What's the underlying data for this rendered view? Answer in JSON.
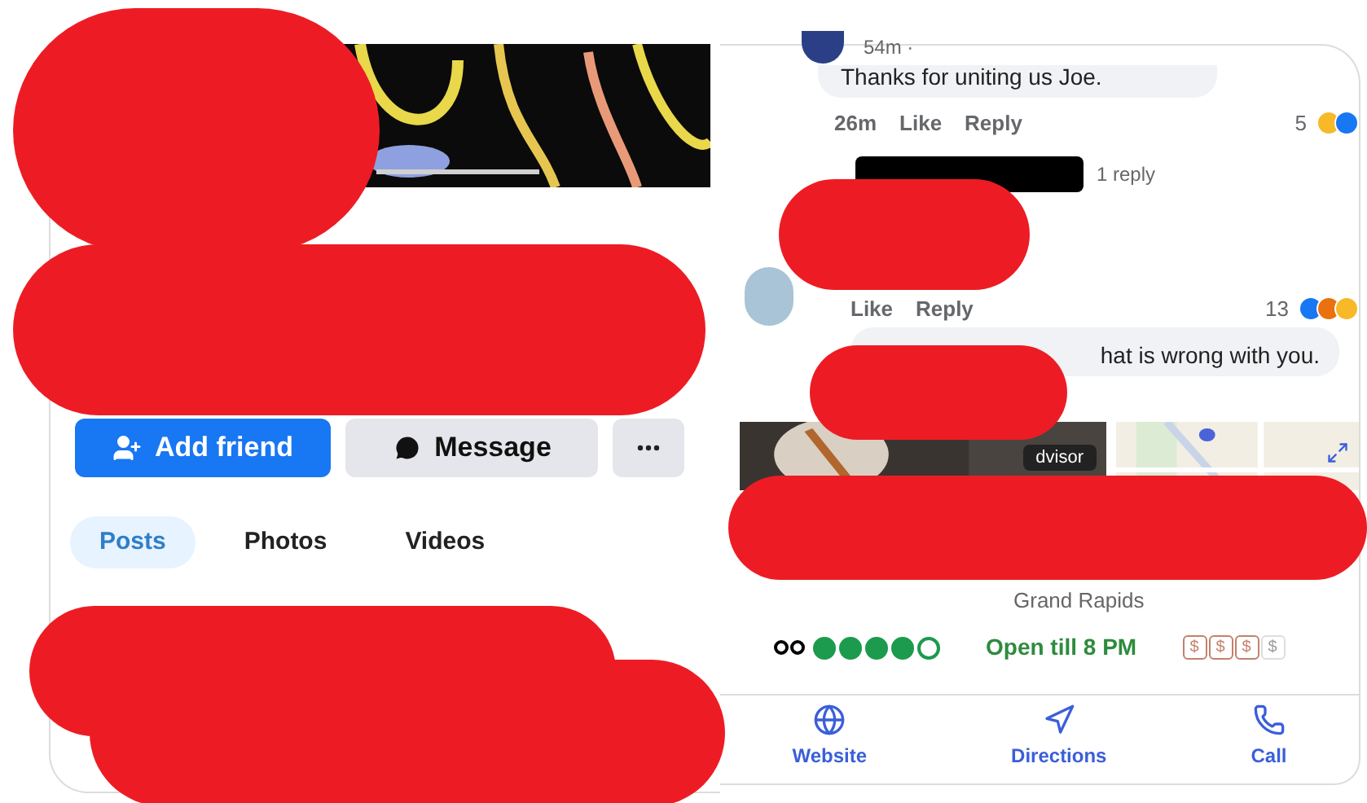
{
  "profile": {
    "buttons": [
      {
        "kind": "add",
        "label": "Add friend"
      },
      {
        "kind": "message",
        "label": "Message"
      },
      {
        "kind": "more"
      }
    ],
    "tabs": [
      {
        "label": "Posts",
        "selected": true
      },
      {
        "label": "Photos",
        "selected": false
      },
      {
        "label": "Videos",
        "selected": false
      }
    ]
  },
  "comments": [
    {
      "time": "54m ·",
      "text": "Thanks for uniting us Joe.",
      "actions": [
        "26m",
        "Like",
        "Reply"
      ],
      "reaction_count": "5",
      "reactions": [
        {
          "kind": "haha"
        },
        {
          "kind": "like"
        }
      ],
      "replies": "1 reply"
    },
    {
      "actions": [
        "Like",
        "Reply"
      ],
      "reaction_count": "13",
      "reactions": [
        {
          "kind": "like"
        },
        {
          "kind": "angry"
        },
        {
          "kind": "haha"
        }
      ],
      "reply_text": "hat is wrong with you."
    }
  ],
  "place": {
    "photo_badge": "dvisor",
    "location": "Grand Rapids",
    "rating": {
      "stars": 4
    },
    "hours": "Open till 8 PM",
    "price": [
      {
        "symbol": "$",
        "on": true
      },
      {
        "symbol": "$",
        "on": true
      },
      {
        "symbol": "$",
        "on": true
      },
      {
        "symbol": "$",
        "on": false
      }
    ],
    "actions": [
      {
        "kind": "website",
        "label": "Website"
      },
      {
        "kind": "directions",
        "label": "Directions"
      },
      {
        "kind": "call",
        "label": "Call"
      }
    ]
  }
}
